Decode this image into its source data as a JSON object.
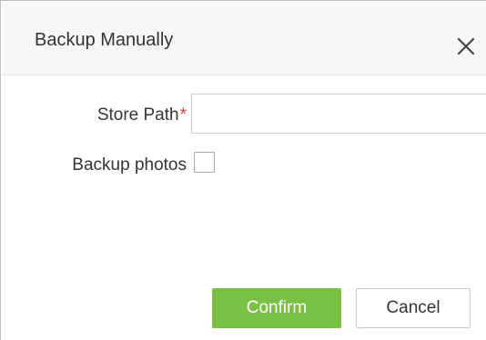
{
  "dialog": {
    "title": "Backup Manually",
    "close_icon": "close-icon"
  },
  "form": {
    "store_path_label": "Store Path",
    "required_marker": "*",
    "store_path_value": "",
    "store_path_placeholder": "",
    "backup_photos_label": "Backup photos",
    "backup_photos_checked": false
  },
  "buttons": {
    "confirm_label": "Confirm",
    "cancel_label": "Cancel"
  },
  "colors": {
    "confirm_bg": "#7ac143",
    "required": "#e53935",
    "header_bg": "#f7f7f7"
  }
}
